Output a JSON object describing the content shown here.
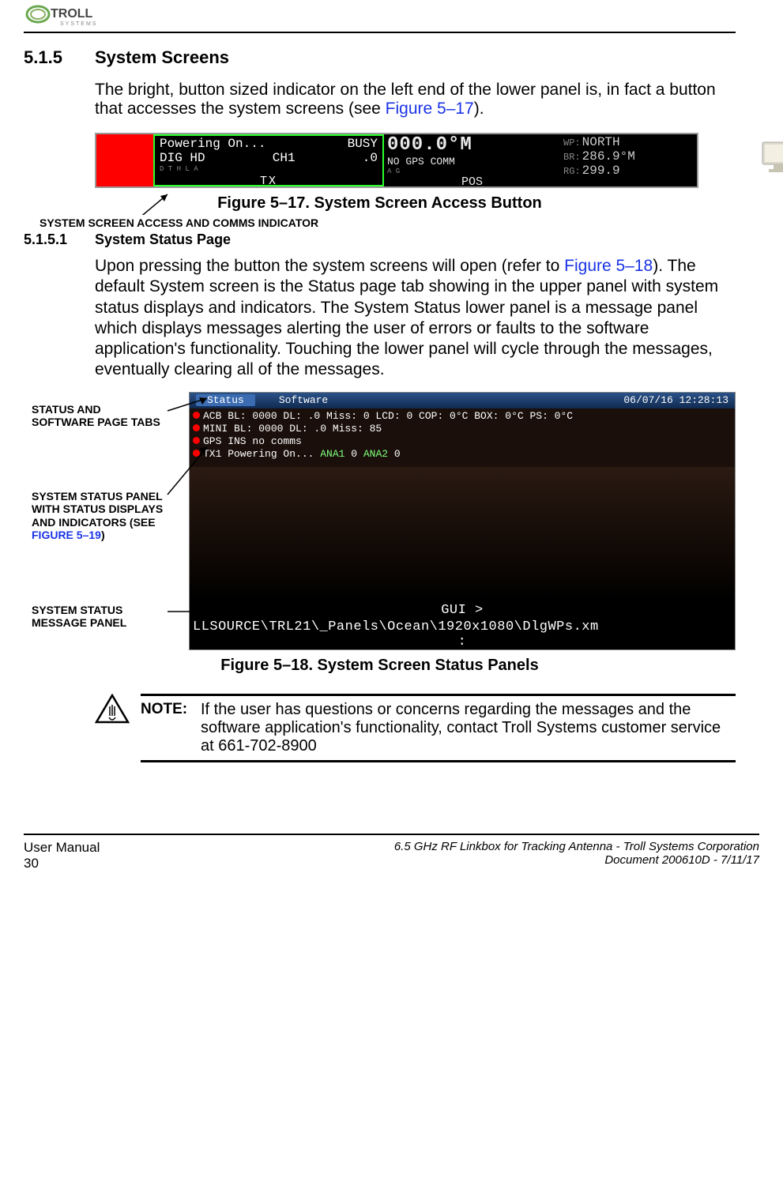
{
  "header_logo_text": "TROLL SYSTEMS",
  "section": {
    "num": "5.1.5",
    "title": "System Screens"
  },
  "para1_a": "The bright, button sized indicator on the left end of the lower panel is, in fact a button that accesses the system screens (see ",
  "para1_link": "Figure 5–17",
  "para1_b": ").",
  "fig17": {
    "tx_line1_left": "Powering On...",
    "tx_line1_right": "BUSY",
    "tx_line2_left": "DIG HD",
    "tx_line2_mid": "CH1",
    "tx_line2_right": ".0",
    "tx_small": "D T            H L A",
    "tx_label": "TX",
    "pos_big": "000.0°M",
    "pos_line2": "NO GPS COMM",
    "pos_small": "A G",
    "pos_label": "POS",
    "wp_lbl": "WP:",
    "wp_val": "NORTH",
    "br_lbl": "BR:",
    "br_val": "286.9°M",
    "rg_lbl": "RG:",
    "rg_val": "299.9",
    "annot": "SYSTEM SCREEN ACCESS AND COMMS INDICATOR",
    "caption": "Figure 5–17.  System Screen Access Button"
  },
  "subsection": {
    "num": "5.1.5.1",
    "title": "System Status Page"
  },
  "para2_a": "Upon pressing the button the system screens will open (refer to ",
  "para2_link": "Figure 5–18",
  "para2_b": "). The default System screen is the Status page tab showing in the upper panel with system status displays and indicators. The System Status lower panel is a message panel which displays messages alerting the user of errors or faults to the software application's functionality. Touching the lower panel will cycle through the messages, eventually clearing all of the messages.",
  "fig18": {
    "ann1": "STATUS AND SOFTWARE PAGE TABS",
    "ann2_a": "SYSTEM STATUS PANEL WITH STATUS DISPLAYS AND INDICATORS (SEE ",
    "ann2_link": "FIGURE 5–19",
    "ann2_b": ")",
    "ann3": "SYSTEM STATUS MESSAGE PANEL",
    "tab_active": "Status",
    "tab2": "Software",
    "timestamp": "06/07/16 12:28:13",
    "row1": "ACB BL: 0000 DL:  .0 Miss:   0   LCD:  0 COP: 0°C BOX: 0°C PS:  0°C",
    "row2": "MINI BL: 0000 DL:  .0 Miss:  85",
    "row3": "GPS              INS no comms",
    "row4_a": "TX1   Powering On... ",
    "row4_b": "ANA1",
    "row4_c": "  0 ",
    "row4_d": "ANA2",
    "row4_e": "  0",
    "gui": "GUI >",
    "msg": "LLSOURCE\\TRL21\\_Panels\\Ocean\\1920x1080\\DlgWPs.xm",
    "msg2": ":",
    "caption": "Figure 5–18.  System Screen Status Panels"
  },
  "note": {
    "label": "NOTE:",
    "text": "If the user has questions or concerns regarding the messages and the software application's functionality, contact Troll Systems customer service at 661-702-8900"
  },
  "footer": {
    "left1": "User Manual",
    "left2": "30",
    "right1": "6.5 GHz RF Linkbox for Tracking Antenna - Troll Systems Corporation",
    "right2": "Document 200610D - 7/11/17"
  }
}
